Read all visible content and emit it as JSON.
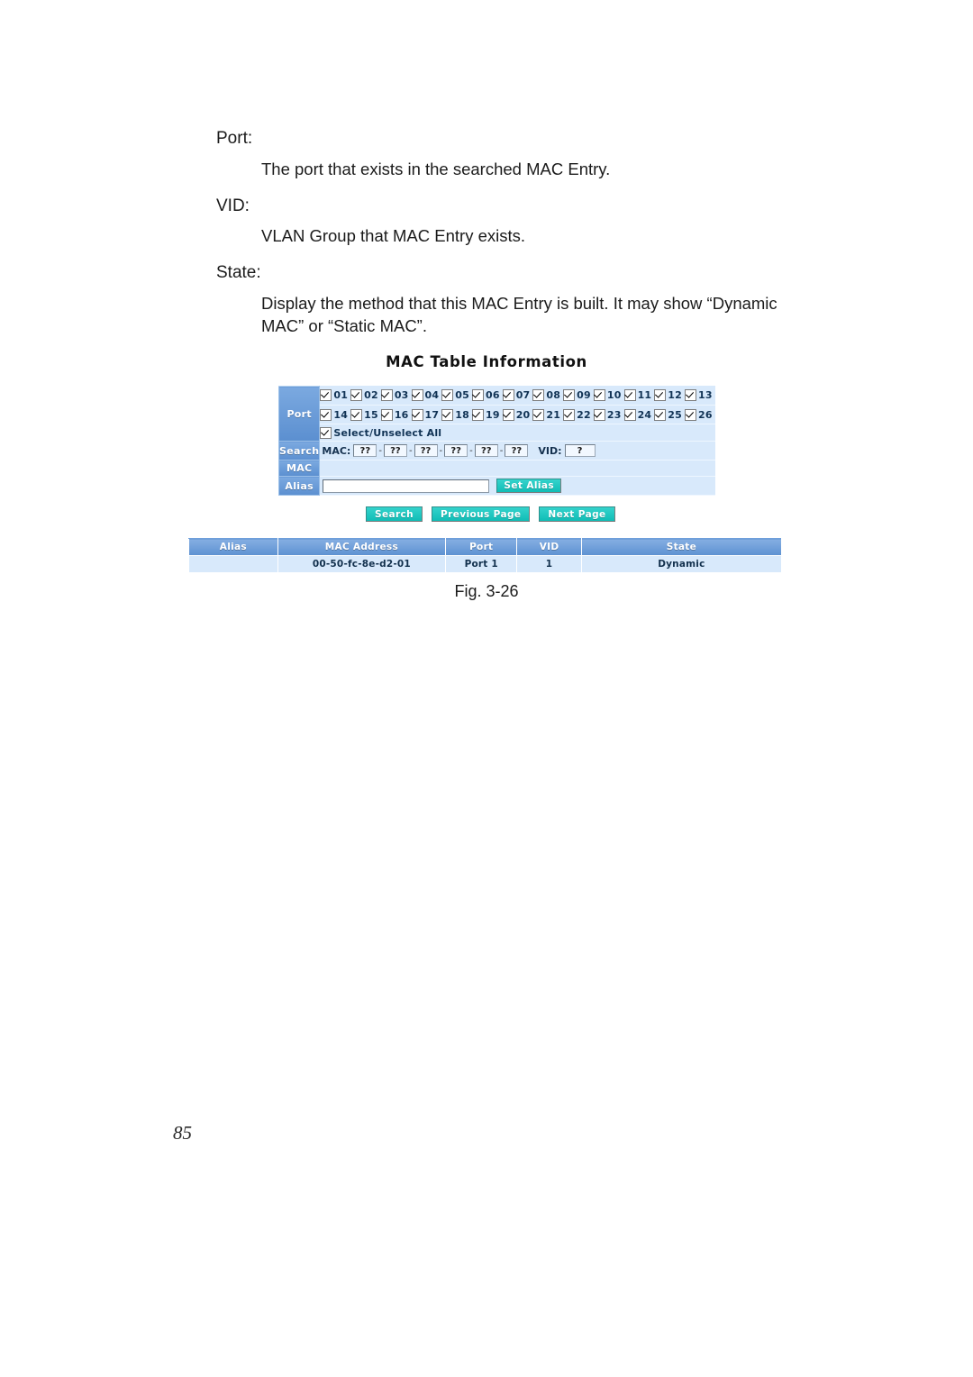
{
  "document": {
    "page_number": "85",
    "definitions": [
      {
        "term": "Port:",
        "description": "The port that exists in the searched MAC Entry."
      },
      {
        "term": "VID:",
        "description": "VLAN Group that MAC Entry exists."
      },
      {
        "term": "State:",
        "description": "Display the method that this MAC Entry is built.  It may show “Dynamic MAC” or “Static MAC”."
      }
    ],
    "figure_caption": "Fig. 3-26"
  },
  "figure": {
    "title": "MAC Table Information",
    "panel": {
      "port_label": "Port",
      "search_label": "Search",
      "mac_label": "MAC",
      "alias_label": "Alias",
      "ports_row1": [
        "01",
        "02",
        "03",
        "04",
        "05",
        "06",
        "07",
        "08",
        "09",
        "10",
        "11",
        "12",
        "13"
      ],
      "ports_row2": [
        "14",
        "15",
        "16",
        "17",
        "18",
        "19",
        "20",
        "21",
        "22",
        "23",
        "24",
        "25",
        "26"
      ],
      "all_ports_checked": true,
      "select_all_label": "Select/Unselect All",
      "select_all_checked": true,
      "mac_field_label": "MAC:",
      "mac_octets": [
        "??",
        "??",
        "??",
        "??",
        "??",
        "??"
      ],
      "octet_separator": "-",
      "vid_field_label": "VID:",
      "vid_value": "?",
      "alias_value": "",
      "alias_placeholder": "",
      "set_alias_button": "Set Alias"
    },
    "actions": {
      "search_button": "Search",
      "previous_page_button": "Previous Page",
      "next_page_button": "Next Page"
    },
    "results_table": {
      "headers": [
        "Alias",
        "MAC Address",
        "Port",
        "VID",
        "State"
      ],
      "rows": [
        {
          "alias": "",
          "mac_address": "00-50-fc-8e-d2-01",
          "port": "Port 1",
          "vid": "1",
          "state": "Dynamic"
        }
      ]
    }
  },
  "colors": {
    "panel_background": "#d8e9fb",
    "header_blue": "#6f9fdb",
    "button_teal": "#1fc9c2",
    "text_dark_blue": "#12304d"
  }
}
